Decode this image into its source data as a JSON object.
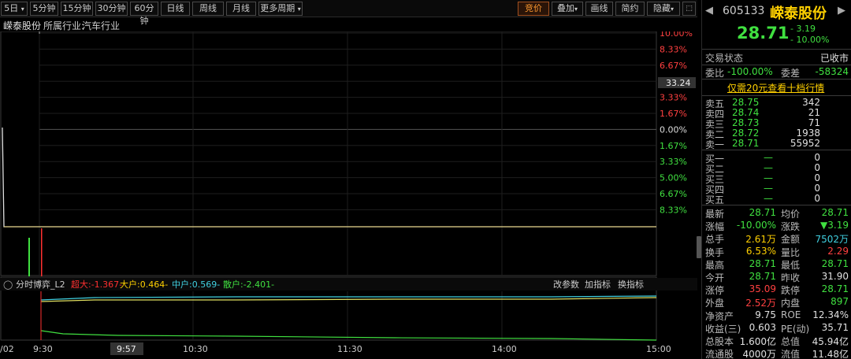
{
  "toolbar": {
    "periods": [
      "5日",
      "5分钟",
      "15分钟",
      "30分钟",
      "60分钟",
      "日线",
      "周线",
      "月线",
      "更多周期"
    ],
    "right": [
      "竞价",
      "叠加",
      "画线",
      "简约",
      "隐藏"
    ]
  },
  "info": {
    "stock": "嵘泰股份",
    "industry_label": "所属行业:",
    "industry": "汽车行业"
  },
  "chart_data": {
    "type": "line",
    "y_right_labels": [
      "10.00%",
      "8.33%",
      "6.67%",
      "5.00%",
      "3.33%",
      "1.67%",
      "0.00%",
      "1.67%",
      "3.33%",
      "5.00%",
      "6.67%",
      "8.33%"
    ],
    "cursor_value": "33.24",
    "x_labels": [
      "9:30",
      "10:30",
      "11:30",
      "14:00",
      "15:00"
    ],
    "x_left_stub": "/02",
    "cursor_time": "9:57",
    "price_close": "28.71",
    "prev_close": "31.90"
  },
  "indicator": {
    "name": "分时博弈_L2",
    "super": "超大:-1.367-",
    "big": "大户:0.464-",
    "mid": "中户:0.569-",
    "small": "散户:-2.401-",
    "btn1": "改参数",
    "btn2": "加指标",
    "btn3": "换指标"
  },
  "quote": {
    "code": "605133",
    "name": "嵘泰股份",
    "price": "28.71",
    "change": "- 3.19",
    "pct": "- 10.00%",
    "status_label": "交易状态",
    "status": "已收市",
    "wb_label": "委比",
    "wb": "-100.00%",
    "wc_label": "委差",
    "wc": "-58324",
    "promo": "仅需20元查看十档行情",
    "asks": [
      {
        "l": "卖五",
        "p": "28.75",
        "v": "342"
      },
      {
        "l": "卖四",
        "p": "28.74",
        "v": "21"
      },
      {
        "l": "卖三",
        "p": "28.73",
        "v": "71"
      },
      {
        "l": "卖二",
        "p": "28.72",
        "v": "1938"
      },
      {
        "l": "卖一",
        "p": "28.71",
        "v": "55952"
      }
    ],
    "bids": [
      {
        "l": "买一",
        "p": "—",
        "v": "0"
      },
      {
        "l": "买二",
        "p": "—",
        "v": "0"
      },
      {
        "l": "买三",
        "p": "—",
        "v": "0"
      },
      {
        "l": "买四",
        "p": "—",
        "v": "0"
      },
      {
        "l": "买五",
        "p": "—",
        "v": "0"
      }
    ],
    "stats": [
      [
        "最新",
        "28.71",
        "均价",
        "28.71"
      ],
      [
        "涨幅",
        "-10.00%",
        "涨跌",
        "▼3.19"
      ],
      [
        "总手",
        "2.61万",
        "金额",
        "7502万"
      ],
      [
        "换手",
        "6.53%",
        "量比",
        "2.29"
      ],
      [
        "最高",
        "28.71",
        "最低",
        "28.71"
      ],
      [
        "今开",
        "28.71",
        "昨收",
        "31.90"
      ],
      [
        "涨停",
        "35.09",
        "跌停",
        "28.71"
      ],
      [
        "外盘",
        "2.52万",
        "内盘",
        "897"
      ],
      [
        "净资产",
        "9.75",
        "ROE",
        "12.34%"
      ],
      [
        "收益(三)",
        "0.603",
        "PE(动)",
        "35.71"
      ],
      [
        "总股本",
        "1.600亿",
        "总值",
        "45.94亿"
      ],
      [
        "流通股",
        "4000万",
        "流值",
        "11.48亿"
      ]
    ]
  }
}
